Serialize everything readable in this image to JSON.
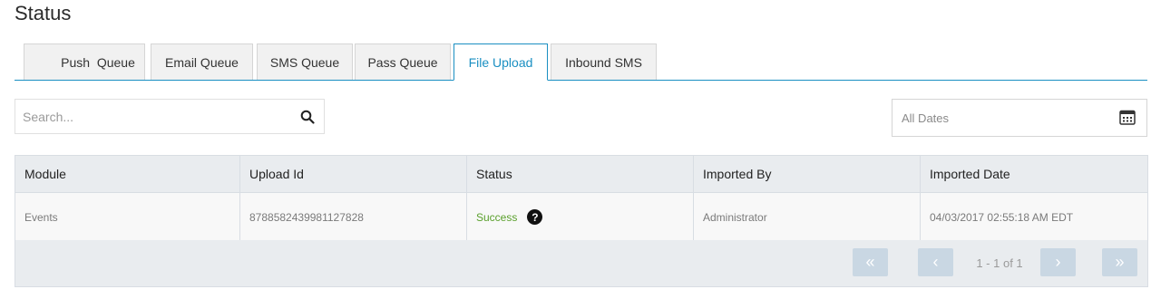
{
  "page": {
    "title": "Status"
  },
  "tabs": [
    {
      "label": "Push  Queue",
      "active": false
    },
    {
      "label": "Email Queue",
      "active": false
    },
    {
      "label": "SMS Queue",
      "active": false
    },
    {
      "label": "Pass Queue",
      "active": false
    },
    {
      "label": "File Upload",
      "active": true
    },
    {
      "label": "Inbound SMS",
      "active": false
    }
  ],
  "search": {
    "placeholder": "Search...",
    "value": ""
  },
  "date_filter": {
    "label": "All Dates"
  },
  "table": {
    "columns": [
      "Module",
      "Upload Id",
      "Status",
      "Imported By",
      "Imported Date"
    ],
    "rows": [
      {
        "module": "Events",
        "upload_id": "8788582439981127828",
        "status": "Success",
        "imported_by": "Administrator",
        "imported_date": "04/03/2017 02:55:18 AM EDT"
      }
    ]
  },
  "pagination": {
    "info": "1 - 1 of 1",
    "first": "«",
    "prev": "‹",
    "next": "›",
    "last": "»"
  },
  "colors": {
    "accent": "#1a8fc2",
    "success": "#5aa02c",
    "header_bg": "#e9ecef",
    "pager_button": "#c9d7e3"
  },
  "icons": {
    "search": "search-icon",
    "calendar": "calendar-icon",
    "help": "help-icon"
  }
}
